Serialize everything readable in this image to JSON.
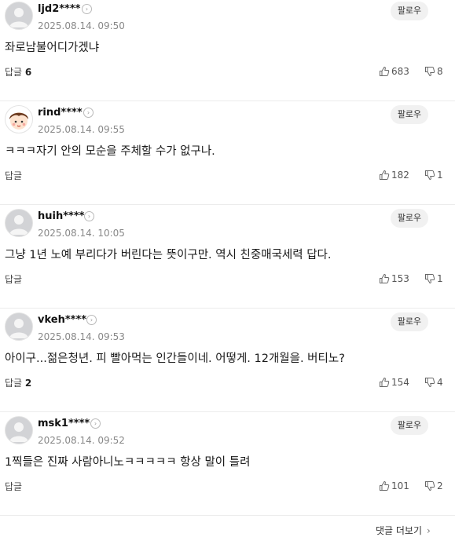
{
  "follow_label": "팔로우",
  "reply_label": "답글",
  "more": {
    "label": "댓글 더보기",
    "chevron": "›"
  },
  "comments": [
    {
      "user": "ljd2****",
      "date": "2025.08.14. 09:50",
      "text": "좌로남불어디가겠냐",
      "replies": "6",
      "likes": "683",
      "dislikes": "8"
    },
    {
      "user": "rind****",
      "date": "2025.08.14. 09:55",
      "text": "ㅋㅋㅋ자기 안의 모순을 주체할 수가 없구나.",
      "replies": "",
      "likes": "182",
      "dislikes": "1"
    },
    {
      "user": "huih****",
      "date": "2025.08.14. 10:05",
      "text": "그냥 1년 노예 부리다가 버린다는 뜻이구만. 역시 친중매국세력 답다.",
      "replies": "",
      "likes": "153",
      "dislikes": "1"
    },
    {
      "user": "vkeh****",
      "date": "2025.08.14. 09:53",
      "text": "아이구...젊은청년. 피 빨아먹는 인간들이네. 어떻게. 12개월을. 버티노?",
      "replies": "2",
      "likes": "154",
      "dislikes": "4"
    },
    {
      "user": "msk1****",
      "date": "2025.08.14. 09:52",
      "text": "1찍들은 진짜 사람아니노ㅋㅋㅋㅋㅋ 항상 말이 틀려",
      "replies": "",
      "likes": "101",
      "dislikes": "2"
    }
  ]
}
